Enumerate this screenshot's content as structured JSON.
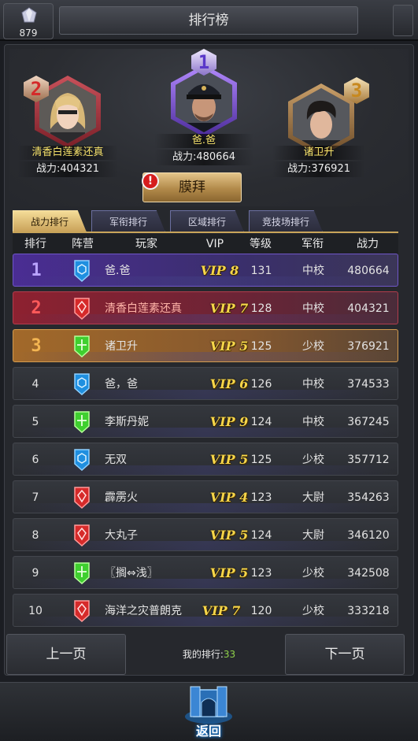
{
  "header": {
    "title": "排行榜",
    "gem_count": "879"
  },
  "podium": {
    "first": {
      "rank": "1",
      "name": "爸.爸",
      "power": "战力:480664"
    },
    "second": {
      "rank": "2",
      "name": "清香白莲素还真",
      "power": "战力:404321"
    },
    "third": {
      "rank": "3",
      "name": "诸卫升",
      "power": "战力:376921"
    },
    "worship_label": "膜拜",
    "alert": "!"
  },
  "tabs": [
    {
      "label": "战力排行",
      "active": true
    },
    {
      "label": "军衔排行",
      "active": false
    },
    {
      "label": "区域排行",
      "active": false
    },
    {
      "label": "竞技场排行",
      "active": false
    }
  ],
  "columns": {
    "rank": "排行",
    "faction": "阵营",
    "player": "玩家",
    "vip": "VIP",
    "level": "等级",
    "title": "军衔",
    "power": "战力"
  },
  "rows": [
    {
      "rank": "1",
      "faction": "blue",
      "name": "爸.爸",
      "vip": "VIP 8",
      "level": "131",
      "title": "中校",
      "power": "480664"
    },
    {
      "rank": "2",
      "faction": "red",
      "name": "清香白莲素还真",
      "vip": "VIP 7",
      "level": "128",
      "title": "中校",
      "power": "404321"
    },
    {
      "rank": "3",
      "faction": "green",
      "name": "诸卫升",
      "vip": "VIP 5",
      "level": "125",
      "title": "少校",
      "power": "376921"
    },
    {
      "rank": "4",
      "faction": "blue",
      "name": "爸，爸",
      "vip": "VIP 6",
      "level": "126",
      "title": "中校",
      "power": "374533"
    },
    {
      "rank": "5",
      "faction": "green",
      "name": "李斯丹妮",
      "vip": "VIP 9",
      "level": "124",
      "title": "中校",
      "power": "367245"
    },
    {
      "rank": "6",
      "faction": "blue",
      "name": "无双",
      "vip": "VIP 5",
      "level": "125",
      "title": "少校",
      "power": "357712"
    },
    {
      "rank": "7",
      "faction": "red",
      "name": "霹雳火",
      "vip": "VIP 4",
      "level": "123",
      "title": "大尉",
      "power": "354263"
    },
    {
      "rank": "8",
      "faction": "red",
      "name": "大丸子",
      "vip": "VIP 5",
      "level": "124",
      "title": "大尉",
      "power": "346120"
    },
    {
      "rank": "9",
      "faction": "green",
      "name": "〖搁⇔浅〗",
      "vip": "VIP 5",
      "level": "123",
      "title": "少校",
      "power": "342508"
    },
    {
      "rank": "10",
      "faction": "red",
      "name": "海洋之灾普朗克",
      "vip": "VIP 7",
      "level": "120",
      "title": "少校",
      "power": "333218"
    }
  ],
  "footer": {
    "prev_label": "上一页",
    "next_label": "下一页",
    "my_rank_label": "我的排行:",
    "my_rank_value": "33"
  },
  "back_label": "返回",
  "colors": {
    "faction_blue": "#1f8fe0",
    "faction_red": "#d62a2a",
    "faction_green": "#3fcf2f",
    "vip_gold": "#f7d649",
    "rank1": "#b9a3ff",
    "rank2": "#ff5a5a",
    "rank3": "#f3b552"
  }
}
